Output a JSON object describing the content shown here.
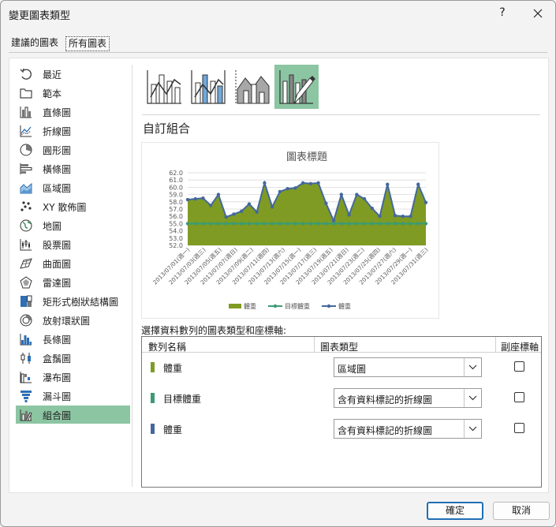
{
  "window": {
    "title": "變更圖表類型",
    "help_label": "?"
  },
  "tabs": {
    "recommended": "建議的圖表",
    "all": "所有圖表"
  },
  "sidebar": {
    "items": [
      {
        "label": "最近",
        "icon": "recent-icon"
      },
      {
        "label": "範本",
        "icon": "folder-icon"
      },
      {
        "label": "直條圖",
        "icon": "column-chart-icon"
      },
      {
        "label": "折線圖",
        "icon": "line-chart-icon"
      },
      {
        "label": "圓形圖",
        "icon": "pie-chart-icon"
      },
      {
        "label": "橫條圖",
        "icon": "bar-chart-icon"
      },
      {
        "label": "區域圖",
        "icon": "area-chart-icon"
      },
      {
        "label": "XY 散佈圖",
        "icon": "scatter-chart-icon"
      },
      {
        "label": "地圖",
        "icon": "map-chart-icon"
      },
      {
        "label": "股票圖",
        "icon": "stock-chart-icon"
      },
      {
        "label": "曲面圖",
        "icon": "surface-chart-icon"
      },
      {
        "label": "雷達圖",
        "icon": "radar-chart-icon"
      },
      {
        "label": "矩形式樹狀結構圖",
        "icon": "treemap-chart-icon"
      },
      {
        "label": "放射環狀圖",
        "icon": "sunburst-chart-icon"
      },
      {
        "label": "長條圖",
        "icon": "histogram-chart-icon"
      },
      {
        "label": "盒鬚圖",
        "icon": "box-whisker-chart-icon"
      },
      {
        "label": "瀑布圖",
        "icon": "waterfall-chart-icon"
      },
      {
        "label": "漏斗圖",
        "icon": "funnel-chart-icon"
      },
      {
        "label": "組合圖",
        "icon": "combo-chart-icon",
        "selected": true
      }
    ]
  },
  "subtypes": [
    {
      "icon": "clustered-column-line-icon"
    },
    {
      "icon": "clustered-column-line-secondary-axis-icon"
    },
    {
      "icon": "stacked-area-clustered-column-icon"
    },
    {
      "icon": "custom-combination-icon",
      "selected": true
    }
  ],
  "section_title": "自訂組合",
  "chart_data": {
    "type": "area",
    "title": "圖表標題",
    "ylim": [
      52.0,
      62.0
    ],
    "yticks": [
      "52.0",
      "53.0",
      "54.0",
      "55.0",
      "56.0",
      "57.0",
      "58.0",
      "59.0",
      "60.0",
      "61.0",
      "62.0"
    ],
    "grid": true,
    "legend_position": "bottom",
    "x_tick_labels": [
      "2013/07/01(週一)",
      "2013/07/03(週三)",
      "2013/07/05(週五)",
      "2013/07/07(週日)",
      "2013/07/09(週二)",
      "2013/07/11(週四)",
      "2013/07/13(週六)",
      "2013/07/15(週一)",
      "2013/07/17(週三)",
      "2013/07/19(週五)",
      "2013/07/21(週日)",
      "2013/07/23(週二)",
      "2013/07/25(週四)",
      "2013/07/27(週六)",
      "2013/07/29(週一)",
      "2013/07/31(週三)"
    ],
    "series": [
      {
        "name": "體重",
        "type": "area",
        "color": "#7f9b23",
        "values": [
          58.3,
          58.4,
          58.5,
          57.5,
          59.0,
          55.9,
          56.3,
          56.7,
          57.7,
          56.6,
          60.6,
          57.3,
          59.4,
          59.8,
          59.9,
          60.6,
          60.5,
          60.6,
          57.8,
          55.4,
          59.0,
          56.2,
          59.0,
          58.4,
          57.1,
          56.0,
          60.4,
          56.1,
          56.0,
          56.0,
          60.4,
          57.9
        ]
      },
      {
        "name": "目標體重",
        "type": "line-markers",
        "color": "#3a9b74",
        "values": [
          55,
          55,
          55,
          55,
          55,
          55,
          55,
          55,
          55,
          55,
          55,
          55,
          55,
          55,
          55,
          55,
          55,
          55,
          55,
          55,
          55,
          55,
          55,
          55,
          55,
          55,
          55,
          55,
          55,
          55,
          55,
          55
        ]
      },
      {
        "name": "體重",
        "type": "line-markers",
        "color": "#44689c",
        "values": [
          58.3,
          58.4,
          58.5,
          57.5,
          59.0,
          55.9,
          56.3,
          56.7,
          57.7,
          56.6,
          60.6,
          57.3,
          59.4,
          59.8,
          59.9,
          60.6,
          60.5,
          60.6,
          57.8,
          55.4,
          59.0,
          56.2,
          59.0,
          58.4,
          57.1,
          56.0,
          60.4,
          56.1,
          56.0,
          56.0,
          60.4,
          57.9
        ]
      }
    ]
  },
  "series_config": {
    "caption": "選擇資料數列的圖表類型和座標軸:",
    "headers": {
      "name": "數列名稱",
      "type": "圖表類型",
      "secondary_axis": "副座標軸"
    },
    "rows": [
      {
        "name": "體重",
        "color": "#7f9b23",
        "chart_type": "區域圖",
        "secondary": false
      },
      {
        "name": "目標體重",
        "color": "#3a9b74",
        "chart_type": "含有資料標記的折線圖",
        "secondary": false
      },
      {
        "name": "體重",
        "color": "#44689c",
        "chart_type": "含有資料標記的折線圖",
        "secondary": false
      }
    ]
  },
  "buttons": {
    "ok": "確定",
    "cancel": "取消"
  }
}
